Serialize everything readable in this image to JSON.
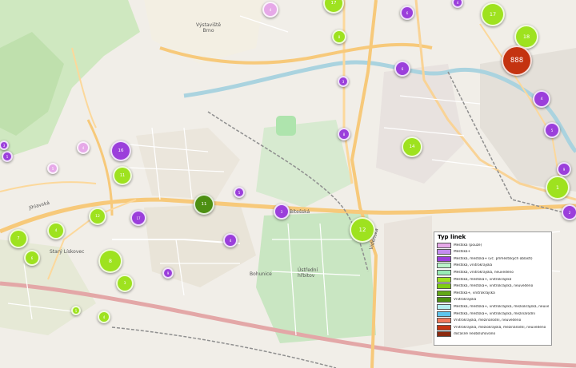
{
  "map": {
    "place_labels": {
      "vystaviste": "Výstaviště\nBrno",
      "stary_liskovec": "Starý Lískovec",
      "bohunice": "Bohunice",
      "ustredni_hrbitov": "Ústřední\nhřbitov",
      "jihlavska": "Jihlavská",
      "bitevni": "Bítešská",
      "vidlice": "Vídeňská"
    },
    "markers": [
      {
        "n": "4",
        "kind": "mestska_plus"
      },
      {
        "n": "17",
        "kind": "mestska_mimo"
      },
      {
        "n": "6",
        "kind": "mestska_mimo_prim"
      },
      {
        "n": "4",
        "kind": "mestska_mimo_prim"
      },
      {
        "n": "17",
        "kind": "mestska_mimo"
      },
      {
        "n": "18",
        "kind": "mestska_mimo"
      },
      {
        "n": "8",
        "kind": "mestska_mimo"
      },
      {
        "n": "888",
        "kind": "dalkova"
      },
      {
        "n": "6",
        "kind": "mestska_mimo_prim"
      },
      {
        "n": "3",
        "kind": "mestska_mimo_prim"
      },
      {
        "n": "4",
        "kind": "mestska_mimo_prim"
      },
      {
        "n": "5",
        "kind": "mestska_mimo_prim"
      },
      {
        "n": "9",
        "kind": "mestska_mimo_prim"
      },
      {
        "n": "8",
        "kind": "mestska_mimo_prim"
      },
      {
        "n": "14",
        "kind": "mestska_mimo"
      },
      {
        "n": "16",
        "kind": "mestska_mimo_prim"
      },
      {
        "n": "11",
        "kind": "mestska_mimo"
      },
      {
        "n": "4",
        "kind": "mestska_plus"
      },
      {
        "n": "5",
        "kind": "mestska_plus"
      },
      {
        "n": "11",
        "kind": "vnitrokrajska_neuv"
      },
      {
        "n": "5",
        "kind": "mestska_mimo_prim"
      },
      {
        "n": "3",
        "kind": "mestska_mimo_prim"
      },
      {
        "n": "12",
        "kind": "mestska_mimo"
      },
      {
        "n": "1",
        "kind": "mestska_mimo"
      },
      {
        "n": "17",
        "kind": "mestska_mimo_prim"
      },
      {
        "n": "7",
        "kind": "mestska_mimo"
      },
      {
        "n": "4",
        "kind": "mestska_mimo"
      },
      {
        "n": "12",
        "kind": "mestska_mimo"
      },
      {
        "n": "6",
        "kind": "mestska_mimo"
      },
      {
        "n": "8",
        "kind": "mestska_mimo"
      },
      {
        "n": "4",
        "kind": "mestska_mimo_prim"
      },
      {
        "n": "9",
        "kind": "mestska_mimo_prim"
      },
      {
        "n": "11",
        "kind": "mestska_mimo_neuv"
      },
      {
        "n": "3",
        "kind": "mestska_mimo"
      },
      {
        "n": "4",
        "kind": "mestska_mimo"
      },
      {
        "n": "5",
        "kind": "mestska_mimo"
      },
      {
        "n": "2",
        "kind": "mestska_mimo_prim"
      },
      {
        "n": "13",
        "kind": "mestska_mimo"
      },
      {
        "n": "14",
        "kind": "mestska_mimo"
      },
      {
        "n": "5",
        "kind": "mestska_mimo_prim"
      },
      {
        "n": "3",
        "kind": "mestska_mimo_prim"
      }
    ]
  },
  "legend": {
    "title": "Typ linek",
    "items": [
      {
        "label": "Městská (pouze)",
        "color": "#e6a9e8"
      },
      {
        "label": "Městská+",
        "color": "#c48cf0"
      },
      {
        "label": "Městská, městská+ (vč. příměstských oblastí)",
        "color": "#9b3fdb"
      },
      {
        "label": "Městská, vnitrokrajská",
        "color": "#b9f3c9"
      },
      {
        "label": "Městská, vnitrokrajská, neuvedeno",
        "color": "#98ecb6"
      },
      {
        "label": "Městská, městská+, vnitrokrajská",
        "color": "#9ee21f"
      },
      {
        "label": "Městská, městská+, vnitrokrajská, neuvedeno",
        "color": "#7fce12"
      },
      {
        "label": "Městská+, vnitrokrajská",
        "color": "#63a817"
      },
      {
        "label": "Vnitrokrajská",
        "color": "#4d8f12"
      },
      {
        "label": "Městská, městská+, vnitrokrajská, meziokrajská, neuvedeno",
        "color": "#b5eef0"
      },
      {
        "label": "Městská, městská+, vnitrokrajská, mezinárodní",
        "color": "#5ec5ec"
      },
      {
        "label": "Vnitrokrajská, mezinárodní, neuvedeno",
        "color": "#f0775a"
      },
      {
        "label": "Vnitrokrajská, meziokrajská, mezinárodní, neuvedeno",
        "color": "#c43310"
      },
      {
        "label": "dočasně neobsluhováno",
        "color": "#8b2a10"
      }
    ]
  },
  "colors": {
    "mestska_plus": "#e6a9e8",
    "mestska_mimo_prim": "#9b3fdb",
    "mestska_mimo": "#9ee21f",
    "mestska_mimo_neuv": "#5ec5ec",
    "vnitrokrajska_neuv": "#4d8f12",
    "dalkova": "#c43310"
  }
}
